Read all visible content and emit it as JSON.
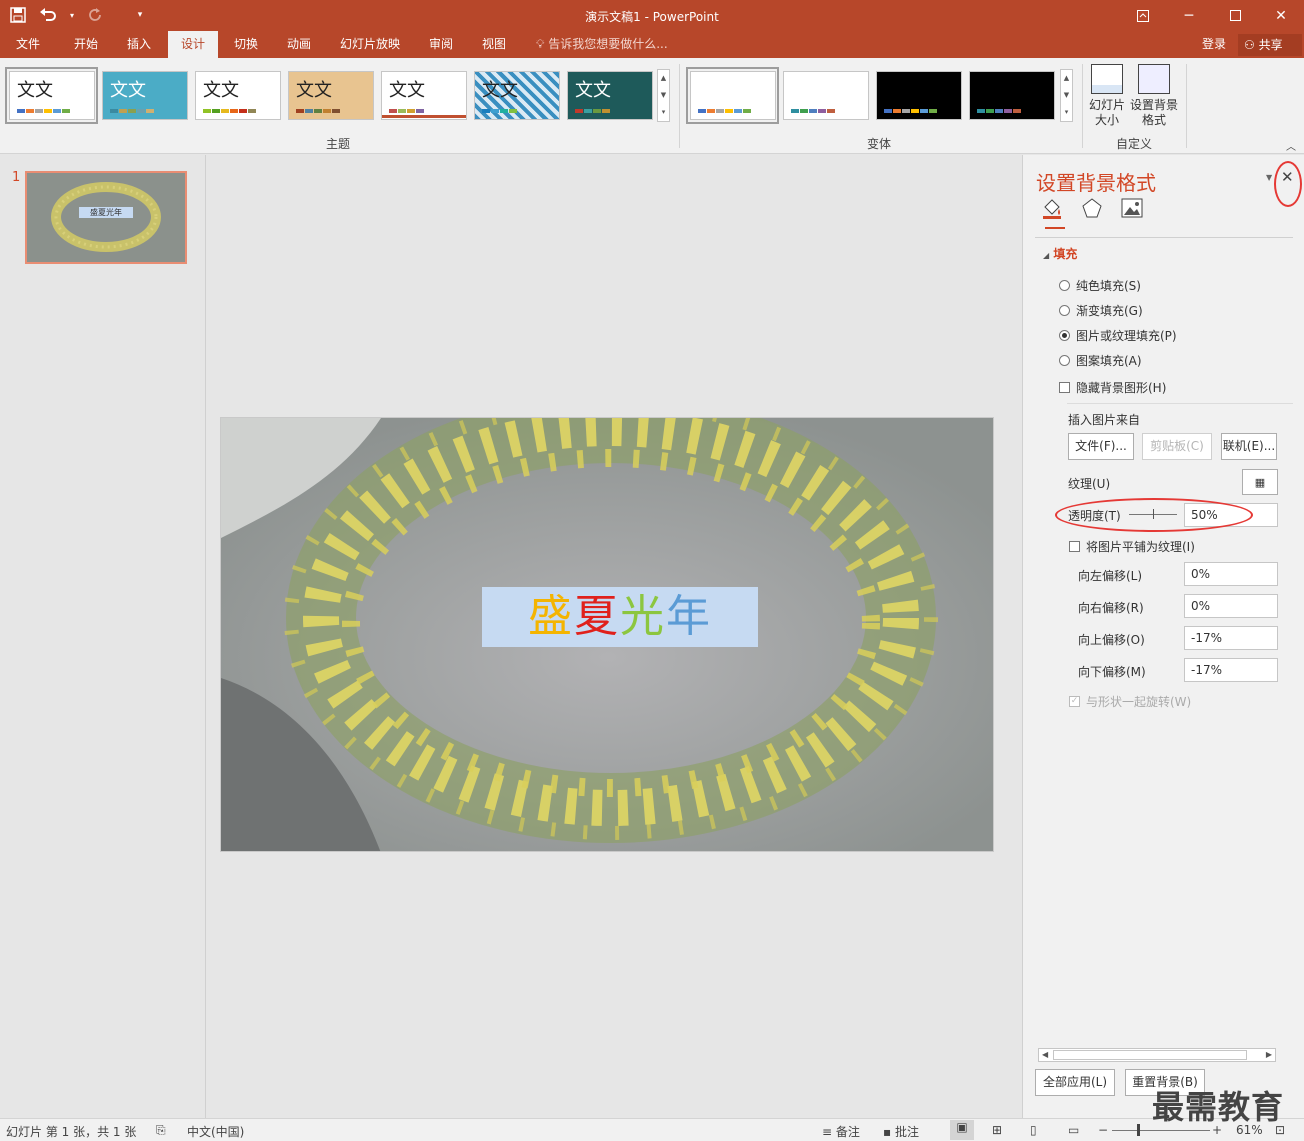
{
  "window": {
    "title": "演示文稿1 - PowerPoint"
  },
  "qat": {
    "save_icon": "save-icon",
    "undo_icon": "undo-icon",
    "redo_icon": "redo-icon",
    "customize_icon": "customize-qat-icon"
  },
  "tabs": [
    {
      "label": "文件"
    },
    {
      "label": "开始"
    },
    {
      "label": "插入"
    },
    {
      "label": "设计"
    },
    {
      "label": "切换"
    },
    {
      "label": "动画"
    },
    {
      "label": "幻灯片放映"
    },
    {
      "label": "审阅"
    },
    {
      "label": "视图"
    }
  ],
  "active_tab": "设计",
  "tell_me": "告诉我您想要做什么...",
  "account": {
    "login": "登录",
    "share": "共享"
  },
  "ribbon": {
    "themes": {
      "label": "主题",
      "preview_text": "文文"
    },
    "variants": {
      "label": "变体"
    },
    "customize": {
      "label": "自定义",
      "slide_size": "幻灯片大小",
      "format_bg": "设置背景格式"
    }
  },
  "slides_pane": {
    "number": "1",
    "thumb_title": "盛夏光年"
  },
  "slide": {
    "title_chars": [
      "盛",
      "夏",
      "光",
      "年"
    ],
    "title_colors": [
      "#f4b400",
      "#e0201b",
      "#8cc63f",
      "#5b9bd5"
    ]
  },
  "format_pane": {
    "title": "设置背景格式",
    "section": "填充",
    "options": [
      {
        "label": "纯色填充(S)",
        "selected": false
      },
      {
        "label": "渐变填充(G)",
        "selected": false
      },
      {
        "label": "图片或纹理填充(P)",
        "selected": true
      },
      {
        "label": "图案填充(A)",
        "selected": false
      }
    ],
    "hide_bg": "隐藏背景图形(H)",
    "insert_from": "插入图片来自",
    "file_btn": "文件(F)...",
    "clipboard_btn": "剪贴板(C)",
    "online_btn": "联机(E)...",
    "texture_label": "纹理(U)",
    "transparency_label": "透明度(T)",
    "transparency_value": "50%",
    "tile": "将图片平铺为纹理(I)",
    "offsets": [
      {
        "label": "向左偏移(L)",
        "value": "0%"
      },
      {
        "label": "向右偏移(R)",
        "value": "0%"
      },
      {
        "label": "向上偏移(O)",
        "value": "-17%"
      },
      {
        "label": "向下偏移(M)",
        "value": "-17%"
      }
    ],
    "rotate_with_shape": "与形状一起旋转(W)",
    "apply_all": "全部应用(L)",
    "reset_bg": "重置背景(B)"
  },
  "status": {
    "slide_info": "幻灯片 第 1 张，共 1 张",
    "language": "中文(中国)",
    "notes": "备注",
    "comments": "批注",
    "zoom": "61%"
  },
  "watermark": "最需教育",
  "colors": {
    "accent": "#b7472a",
    "pane_title": "#d24726",
    "annotation": "#e53935"
  }
}
